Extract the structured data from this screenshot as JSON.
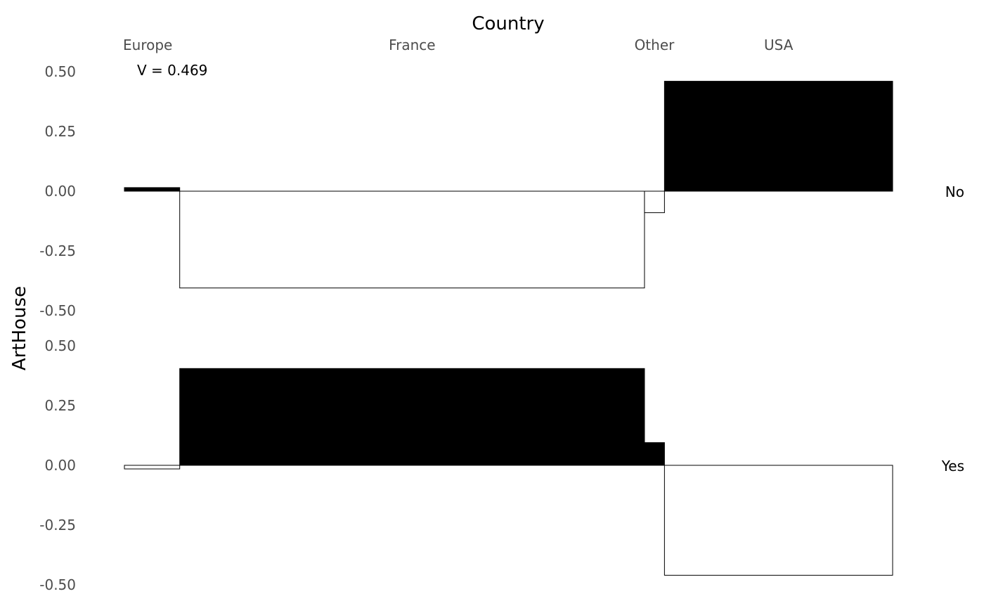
{
  "chart_data": {
    "type": "bar",
    "title": "",
    "xlabel": "Country",
    "ylabel": "ArtHouse",
    "categories": [
      "Europe",
      "France",
      "Other",
      "USA"
    ],
    "category_widths": [
      0.072,
      0.605,
      0.026,
      0.297
    ],
    "rows": [
      "No",
      "Yes"
    ],
    "series": [
      {
        "name": "No",
        "values": [
          0.015,
          -0.405,
          -0.09,
          0.46
        ]
      },
      {
        "name": "Yes",
        "values": [
          -0.015,
          0.405,
          0.095,
          -0.46
        ]
      }
    ],
    "ylim": [
      -0.5,
      0.5
    ],
    "yticks": [
      "0.50",
      "0.25",
      "0.00",
      "-0.25",
      "-0.50"
    ],
    "annotation": "V = 0.469",
    "positive_fill": "#000000",
    "negative_fill": "#ffffff",
    "outline": "#000000",
    "grid": false
  }
}
